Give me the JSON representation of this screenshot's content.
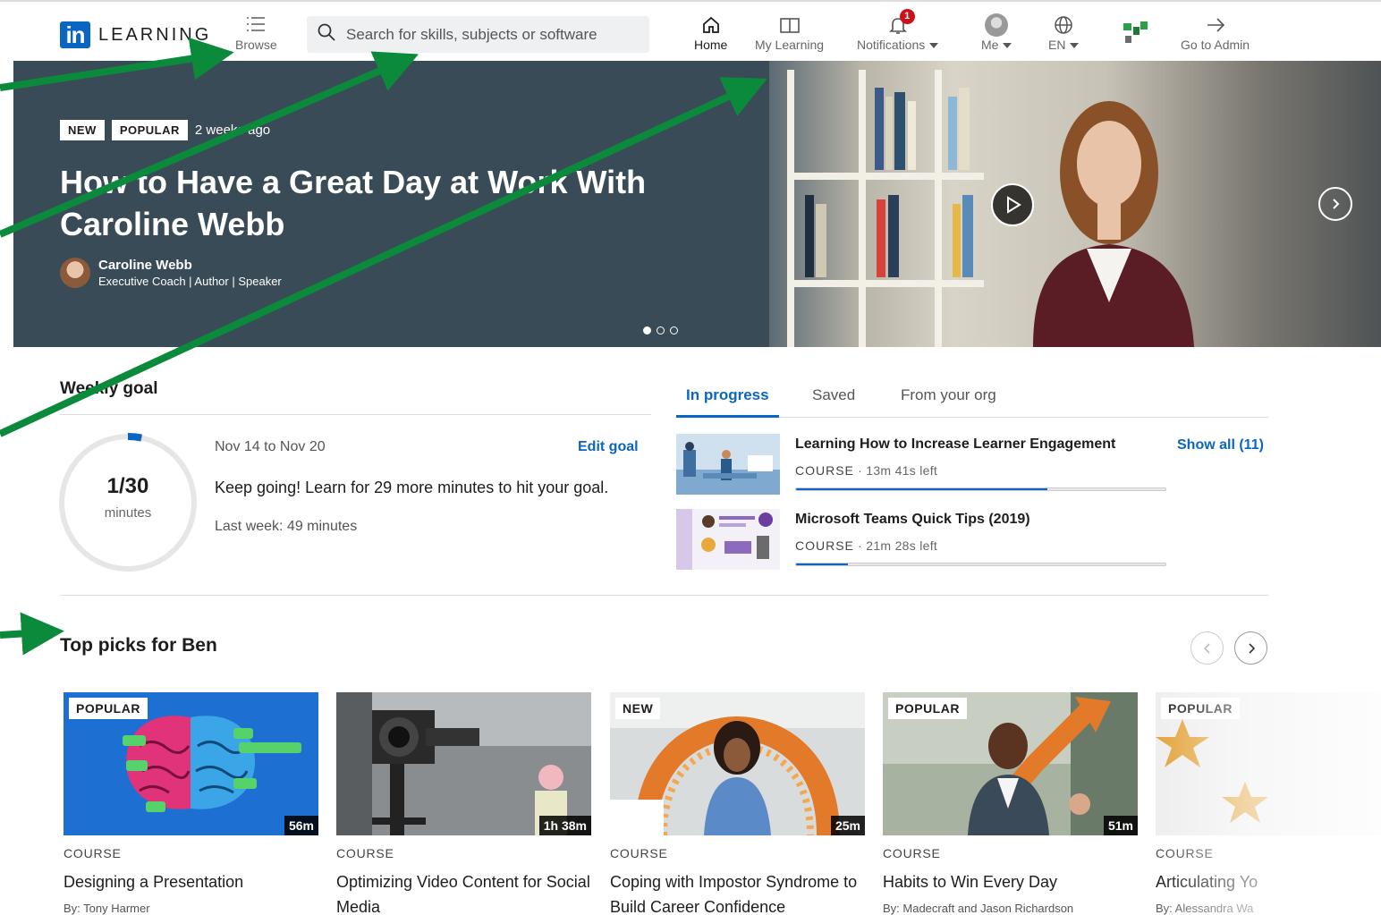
{
  "nav": {
    "logo_in": "in",
    "logo_text": "LEARNING",
    "browse": "Browse",
    "search_placeholder": "Search for skills, subjects or software",
    "home": "Home",
    "my_learning": "My Learning",
    "notifications": "Notifications",
    "notifications_count": "1",
    "me": "Me",
    "lang": "EN",
    "go_to_admin": "Go to Admin"
  },
  "hero": {
    "tag_new": "NEW",
    "tag_popular": "POPULAR",
    "time": "2 weeks ago",
    "title": "How to Have a Great Day at Work With Caroline Webb",
    "author_name": "Caroline Webb",
    "author_role": "Executive Coach | Author | Speaker"
  },
  "weekly_goal": {
    "title": "Weekly goal",
    "dates": "Nov 14 to Nov 20",
    "edit": "Edit goal",
    "value": "1/30",
    "unit": "minutes",
    "progress_fraction": 0.033,
    "message": "Keep going! Learn for 29 more minutes to hit your goal.",
    "last_week": "Last week: 49 minutes"
  },
  "progress_tabs": {
    "tabs": [
      "In progress",
      "Saved",
      "From your org"
    ],
    "show_all": "Show all (11)",
    "items": [
      {
        "title": "Learning How to Increase Learner Engagement",
        "kind": "COURSE",
        "left": "13m 41s left",
        "progress": 0.68
      },
      {
        "title": "Microsoft Teams Quick Tips (2019)",
        "kind": "COURSE",
        "left": "21m 28s left",
        "progress": 0.14
      }
    ]
  },
  "top_picks": {
    "title": "Top picks for Ben",
    "cards": [
      {
        "tag": "POPULAR",
        "duration": "56m",
        "kind": "COURSE",
        "title": "Designing a Presentation",
        "by": "By: Tony Harmer"
      },
      {
        "tag": "",
        "duration": "1h 38m",
        "kind": "COURSE",
        "title": "Optimizing Video Content for Social Media",
        "by": ""
      },
      {
        "tag": "NEW",
        "duration": "25m",
        "kind": "COURSE",
        "title": "Coping with Impostor Syndrome to Build Career Confidence",
        "by": ""
      },
      {
        "tag": "POPULAR",
        "duration": "51m",
        "kind": "COURSE",
        "title": "Habits to Win Every Day",
        "by": "By: Madecraft and Jason Richardson"
      },
      {
        "tag": "POPULAR",
        "duration": "",
        "kind": "COURSE",
        "title": "Articulating Yo",
        "by": "By: Alessandra Wa"
      }
    ]
  },
  "colors": {
    "brand_blue": "#0a66c2",
    "hero_bg": "#394b56",
    "annotation_arrow": "#0a8a3a",
    "notification_red": "#cc1016"
  }
}
